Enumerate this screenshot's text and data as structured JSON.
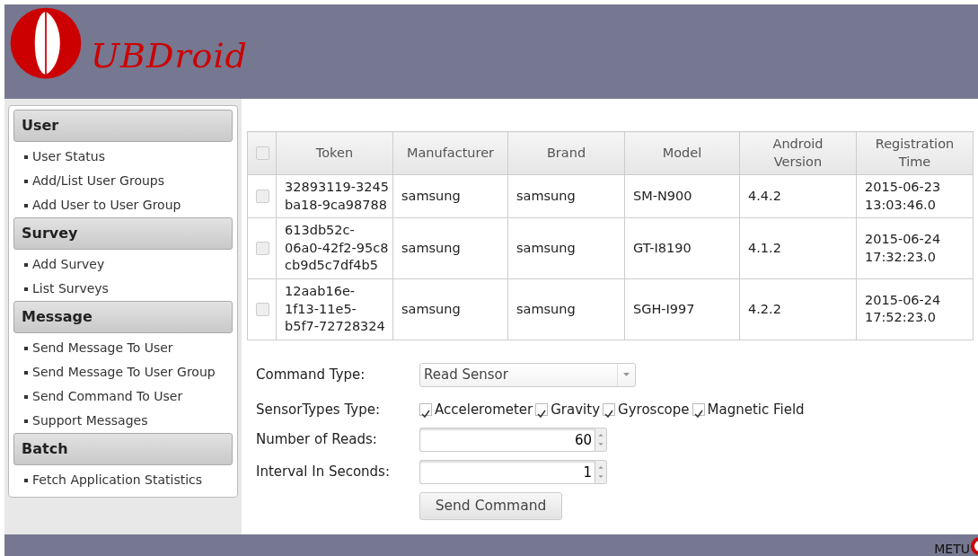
{
  "header": {
    "logo_text": "UBDroid"
  },
  "sidebar": {
    "sections": [
      {
        "title": "User",
        "items": [
          "User Status",
          "Add/List User Groups",
          "Add User to User Group"
        ]
      },
      {
        "title": "Survey",
        "items": [
          "Add Survey",
          "List Surveys"
        ]
      },
      {
        "title": "Message",
        "items": [
          "Send Message To User",
          "Send Message To User Group",
          "Send Command To User",
          "Support Messages"
        ]
      },
      {
        "title": "Batch",
        "items": [
          "Fetch Application Statistics"
        ]
      }
    ]
  },
  "table": {
    "select_all_checked": false,
    "columns": [
      [
        "Token"
      ],
      [
        "Manufacturer"
      ],
      [
        "Brand"
      ],
      [
        "Model"
      ],
      [
        "Android",
        "Version"
      ],
      [
        "Registration",
        "Time"
      ]
    ],
    "rows": [
      {
        "checked": false,
        "token": [
          "32893119-3245",
          "ba18-9ca98788"
        ],
        "manufacturer": "samsung",
        "brand": "samsung",
        "model": "SM-N900",
        "android_version": "4.4.2",
        "registration_time": [
          "2015-06-23",
          "13:03:46.0"
        ]
      },
      {
        "checked": false,
        "token": [
          "613db52c-",
          "06a0-42f2-95c8",
          "cb9d5c7df4b5"
        ],
        "manufacturer": "samsung",
        "brand": "samsung",
        "model": "GT-I8190",
        "android_version": "4.1.2",
        "registration_time": [
          "2015-06-24",
          "17:32:23.0"
        ]
      },
      {
        "checked": false,
        "token": [
          "12aab16e-",
          "1f13-11e5-",
          "b5f7-72728324"
        ],
        "manufacturer": "samsung",
        "brand": "samsung",
        "model": "SGH-I997",
        "android_version": "4.2.2",
        "registration_time": [
          "2015-06-24",
          "17:52:23.0"
        ]
      }
    ]
  },
  "form": {
    "command_type": {
      "label": "Command Type:",
      "value": "Read Sensor"
    },
    "sensor_types": {
      "label": "SensorTypes Type:",
      "options": [
        {
          "label": "Accelerometer",
          "checked": true
        },
        {
          "label": "Gravity",
          "checked": true
        },
        {
          "label": "Gyroscope",
          "checked": true
        },
        {
          "label": "Magnetic Field",
          "checked": true
        }
      ]
    },
    "number_of_reads": {
      "label": "Number of Reads:",
      "value": "60"
    },
    "interval": {
      "label": "Interval In Seconds:",
      "value": "1"
    },
    "submit": "Send Command"
  },
  "footer": {
    "text": "METU"
  }
}
